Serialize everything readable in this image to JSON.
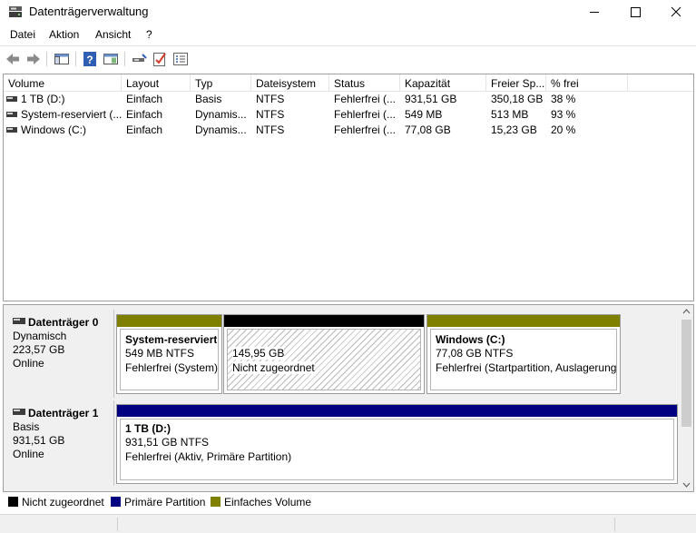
{
  "window": {
    "title": "Datenträgerverwaltung",
    "icon": "disk-management-icon"
  },
  "menu": [
    "Datei",
    "Aktion",
    "Ansicht",
    "?"
  ],
  "toolbar": {
    "buttons": [
      "back-arrow-icon",
      "forward-arrow-icon",
      "console-tree-icon",
      "help-icon",
      "show-hide-pane-icon",
      "connect-icon",
      "check-icon",
      "properties-icon"
    ]
  },
  "volume_list": {
    "columns": [
      "Volume",
      "Layout",
      "Typ",
      "Dateisystem",
      "Status",
      "Kapazität",
      "Freier Sp...",
      "% frei"
    ],
    "rows": [
      [
        "1 TB (D:)",
        "Einfach",
        "Basis",
        "NTFS",
        "Fehlerfrei (...",
        "931,51 GB",
        "350,18 GB",
        "38 %"
      ],
      [
        "System-reserviert (...",
        "Einfach",
        "Dynamis...",
        "NTFS",
        "Fehlerfrei (...",
        "549 MB",
        "513 MB",
        "93 %"
      ],
      [
        "Windows (C:)",
        "Einfach",
        "Dynamis...",
        "NTFS",
        "Fehlerfrei (...",
        "77,08 GB",
        "15,23 GB",
        "20 %"
      ]
    ]
  },
  "disks": [
    {
      "name": "Datenträger 0",
      "type": "Dynamisch",
      "size": "223,57 GB",
      "state": "Online",
      "partitions": [
        {
          "title": "System-reserviert",
          "size": "549 MB NTFS",
          "status": "Fehlerfrei (System)",
          "color": "#808000"
        },
        {
          "title": "",
          "size": "145,95 GB",
          "status": "Nicht zugeordnet",
          "color": "#000000"
        },
        {
          "title": "Windows  (C:)",
          "size": "77,08 GB NTFS",
          "status": "Fehlerfrei (Startpartition, Auslagerung",
          "color": "#808000"
        }
      ]
    },
    {
      "name": "Datenträger 1",
      "type": "Basis",
      "size": "931,51 GB",
      "state": "Online",
      "partitions": [
        {
          "title": "1 TB  (D:)",
          "size": "931,51 GB NTFS",
          "status": "Fehlerfrei (Aktiv, Primäre Partition)",
          "color": "#000080"
        }
      ]
    }
  ],
  "legend": [
    {
      "label": "Nicht zugeordnet",
      "color": "#000000"
    },
    {
      "label": "Primäre Partition",
      "color": "#000080"
    },
    {
      "label": "Einfaches Volume",
      "color": "#808000"
    }
  ]
}
